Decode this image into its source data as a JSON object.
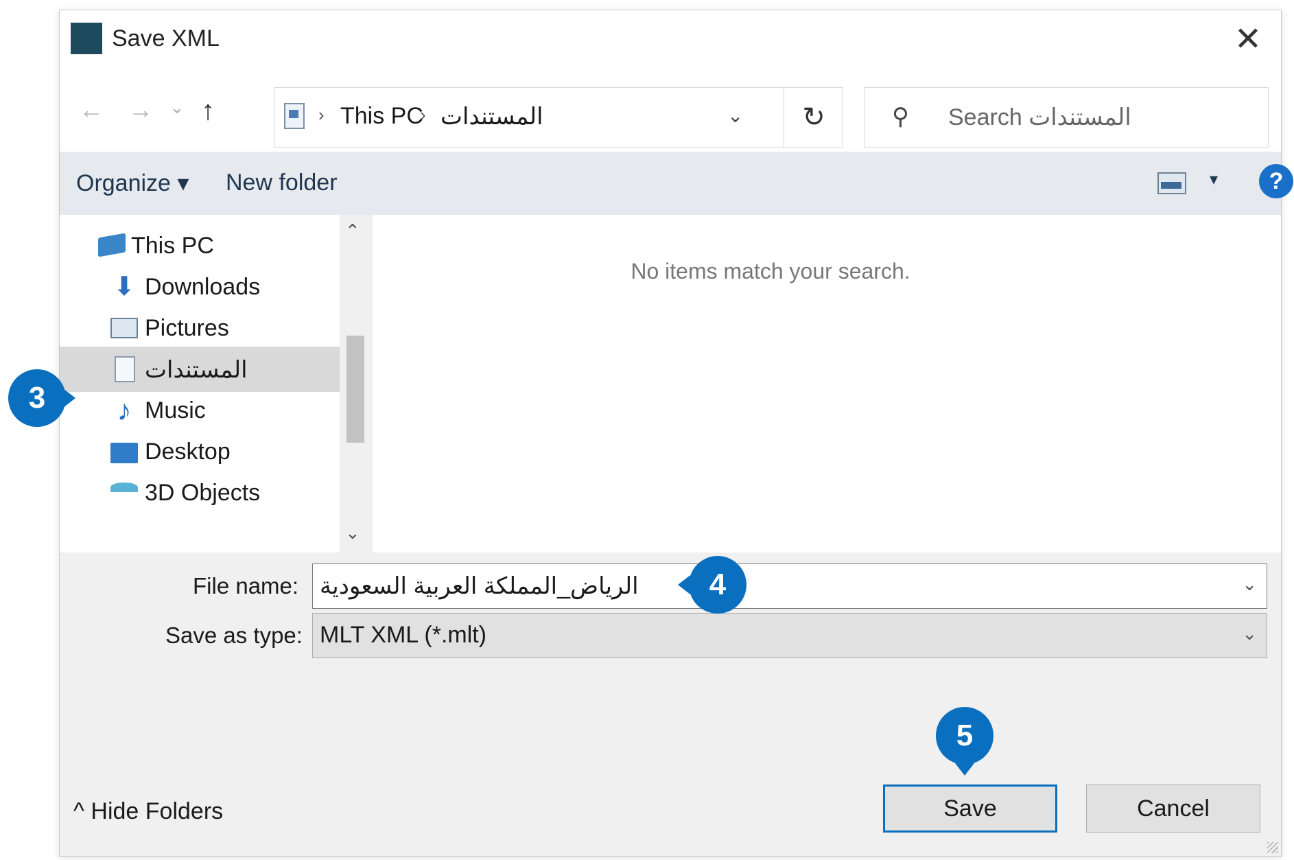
{
  "window": {
    "title": "Save XML",
    "close_glyph": "✕"
  },
  "nav": {
    "back": "←",
    "forward": "→",
    "recent": "⌄",
    "up": "↑"
  },
  "address": {
    "breadcrumbs": [
      "This PC",
      "المستندات"
    ],
    "separator": "›",
    "dropdown_glyph": "⌄",
    "refresh_glyph": "↻"
  },
  "search": {
    "icon": "search-icon",
    "glyph": "⚲",
    "value": "Search المستندات"
  },
  "toolbar": {
    "organize": "Organize ▾",
    "new_folder": "New folder",
    "view_dropdown": "▾",
    "help": "?"
  },
  "sidebar": {
    "items": [
      {
        "label": "This PC",
        "icon": "computer-icon"
      },
      {
        "label": "Downloads",
        "icon": "download-arrow-icon"
      },
      {
        "label": "Pictures",
        "icon": "pictures-icon"
      },
      {
        "label": "المستندات",
        "icon": "document-icon",
        "selected": true
      },
      {
        "label": "Music",
        "icon": "music-note-icon"
      },
      {
        "label": "Desktop",
        "icon": "desktop-icon"
      },
      {
        "label": "3D Objects",
        "icon": "3d-objects-icon"
      }
    ],
    "scroll_up": "⌃",
    "scroll_down": "⌄"
  },
  "content": {
    "empty_message": "No items match your search."
  },
  "form": {
    "file_name_label": "File name:",
    "file_name_value": "الرياض_المملكة العربية السعودية",
    "save_type_label": "Save as type:",
    "save_type_value": "MLT XML (*.mlt)",
    "chevron": "⌄"
  },
  "footer": {
    "hide_folders": "^  Hide Folders",
    "save": "Save",
    "cancel": "Cancel"
  },
  "callouts": {
    "step3": "3",
    "step4": "4",
    "step5": "5"
  },
  "colors": {
    "accent": "#0a6fbf",
    "toolbar_bg": "#e6eaee",
    "selected_bg": "#d9d9d9",
    "help_blue": "#1a70c8"
  }
}
